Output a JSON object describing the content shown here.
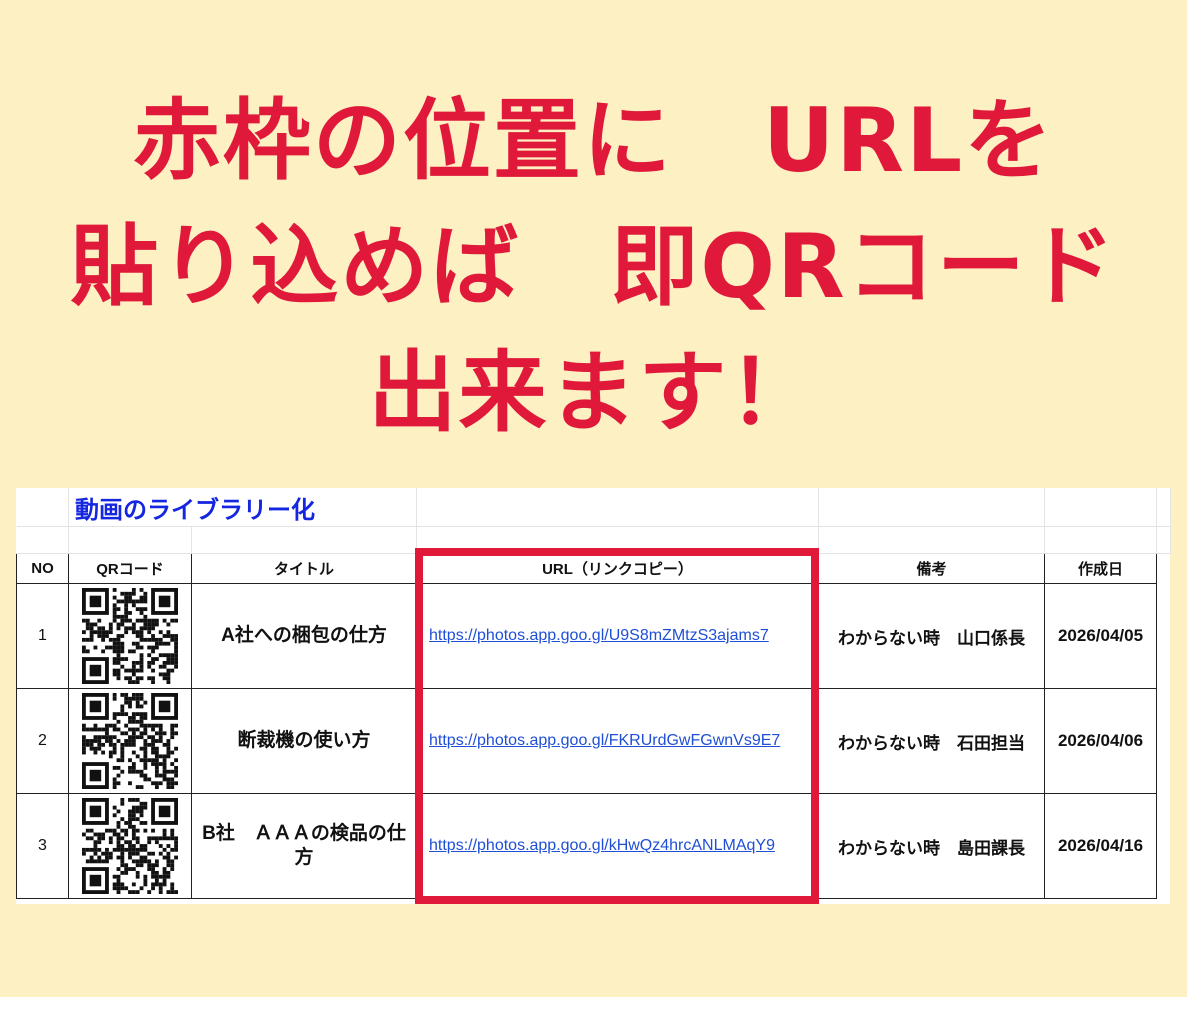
{
  "headline": {
    "line1": "赤枠の位置に　URLを",
    "line2": "貼り込めば　即QRコード",
    "line3": "出来ます！"
  },
  "sheet": {
    "title": "動画のライブラリー化",
    "headers": {
      "no": "NO",
      "qr": "QRコード",
      "title": "タイトル",
      "url": "URL（リンクコピー）",
      "note": "備考",
      "date": "作成日"
    },
    "rows": [
      {
        "no": "1",
        "title": "A社への梱包の仕方",
        "url": "https://photos.app.goo.gl/U9S8mZMtzS3ajams7",
        "note": "わからない時　山口係長",
        "date": "2026/04/05"
      },
      {
        "no": "2",
        "title": "断裁機の使い方",
        "url": "https://photos.app.goo.gl/FKRUrdGwFGwnVs9E7",
        "note": "わからない時　石田担当",
        "date": "2026/04/06"
      },
      {
        "no": "3",
        "title": "B社　ＡＡＡの検品の仕方",
        "url": "https://photos.app.goo.gl/kHwQz4hrcANLMAqY9",
        "note": "わからない時　島田課長",
        "date": "2026/04/16"
      }
    ]
  },
  "colors": {
    "banner_bg": "#fdf0c3",
    "headline": "#e0193a",
    "frame": "#e0193a",
    "sheet_title": "#1426e0",
    "link": "#1f4fd6"
  },
  "icons": {
    "qr": "qr-code-icon"
  }
}
